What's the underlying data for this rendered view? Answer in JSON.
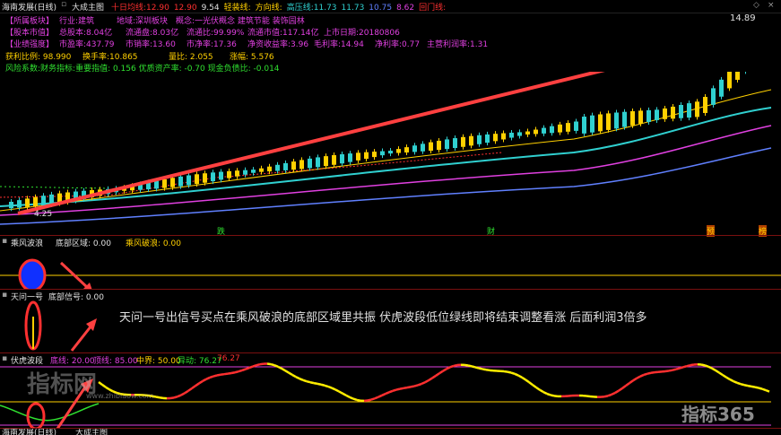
{
  "header": {
    "title": "海南发展(日线)",
    "indicator_name": "大成主图",
    "items": [
      {
        "label": "十日均线:",
        "value": "12.90",
        "color": "#ff3030"
      },
      {
        "label": "",
        "value": "12.90",
        "color": "#ff3030"
      },
      {
        "label": "",
        "value": "9.54",
        "color": "#e0e0e0"
      },
      {
        "label": "轻装线:",
        "value": "",
        "color": "#ffd000"
      },
      {
        "label": "方向线:",
        "value": "",
        "color": "#ffd000"
      },
      {
        "label": "高压线:",
        "value": "11.73",
        "color": "#30d0d0"
      },
      {
        "label": "",
        "value": "11.73",
        "color": "#30d0d0"
      },
      {
        "label": "",
        "value": "10.75",
        "color": "#6080ff"
      },
      {
        "label": "",
        "value": "8.62",
        "color": "#e040e0"
      },
      {
        "label": "回门线:",
        "value": "",
        "color": "#ff3030"
      }
    ],
    "window_controls": [
      "◇",
      "×"
    ]
  },
  "info": {
    "row1": [
      {
        "text": "【所属板块】",
        "color": "#e040e0"
      },
      {
        "text": "行业:建筑",
        "color": "#e040e0"
      },
      {
        "text": "地域:深圳板块",
        "color": "#e040e0"
      },
      {
        "text": "概念:一光伏概念 建筑节能 装饰园林",
        "color": "#e040e0"
      }
    ],
    "row2": [
      {
        "text": "【股本市值】",
        "color": "#e040e0"
      },
      {
        "text": "总股本:8.04亿",
        "color": "#e040e0"
      },
      {
        "text": "流通盘:8.03亿",
        "color": "#e040e0"
      },
      {
        "text": "流通比:99.99%",
        "color": "#e040e0"
      },
      {
        "text": "流通市值:117.14亿",
        "color": "#e040e0"
      },
      {
        "text": "上市日期:20180806",
        "color": "#e040e0"
      }
    ],
    "row3": [
      {
        "text": "【业绩强度】",
        "color": "#e040e0"
      },
      {
        "text": "市盈率:437.79",
        "color": "#e040e0"
      },
      {
        "text": "市销率:13.60",
        "color": "#e040e0"
      },
      {
        "text": "市净率:17.36",
        "color": "#e040e0"
      },
      {
        "text": "净资收益率:3.96",
        "color": "#e040e0"
      },
      {
        "text": "毛利率:14.94",
        "color": "#e040e0"
      },
      {
        "text": "净利率:0.77",
        "color": "#e040e0"
      },
      {
        "text": "主营利润率:1.31",
        "color": "#e040e0"
      }
    ],
    "row4": [
      {
        "text": "获利比例: 98.990",
        "color": "#ffd000"
      },
      {
        "text": "换手率:10.865",
        "color": "#ffd000"
      },
      {
        "text": "量比: 2.055",
        "color": "#ffd000"
      },
      {
        "text": "涨幅: 5.576",
        "color": "#ffd000"
      }
    ],
    "row5": [
      {
        "text": "风险系数:财务指标:重要指值: 0.156 优质资产率: -0.70 现金负债比: -0.014",
        "color": "#30e030"
      }
    ]
  },
  "price_labels": {
    "high": "14.89",
    "low": "4.25"
  },
  "markers": [
    {
      "text": "跌",
      "color": "#30e030"
    },
    {
      "text": "财",
      "color": "#30e030"
    },
    {
      "text": "预",
      "color": "#ffd000"
    },
    {
      "text": "榜",
      "color": "#ffd000"
    }
  ],
  "panel_wind": {
    "label1": "乘风波浪",
    "label2": "底部区域: 0.00",
    "label3": "乘风破浪: 0.00"
  },
  "panel_tianwen": {
    "label1": "天问一号",
    "label2": "底部信号: 0.00",
    "annotation": "天问一号出信号买点在乘风破浪的底部区域里共振 伏虎波段低位绿线即将结束调整看涨 后面利润3倍多"
  },
  "panel_fuhu": {
    "label": "伏虎波段",
    "items": [
      {
        "text": "底线: 20.00",
        "color": "#e040e0"
      },
      {
        "text": "顶线: 85.00",
        "color": "#e040e0"
      },
      {
        "text": "中界: 50.00",
        "color": "#ffd000"
      },
      {
        "text": "异动: 76.27",
        "color": "#30e030"
      },
      {
        "text": "76.27",
        "color": "#ff3030"
      }
    ]
  },
  "watermarks": {
    "left_logo": "指标网",
    "left_url": "www.zhibiaow.com",
    "right_logo": "指标365"
  },
  "bottom_strip": {
    "title": "海南发展(日线)",
    "indicator": "大成主图"
  },
  "colors": {
    "background": "#000000",
    "separator": "#7a1010",
    "up": "#ffd000",
    "down": "#30d0d0",
    "arrow": "#ff4040"
  }
}
